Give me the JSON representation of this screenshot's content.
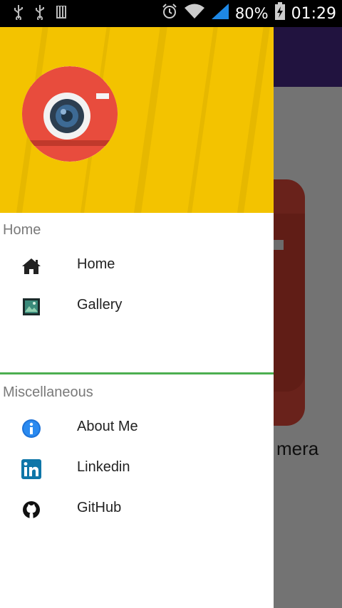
{
  "status_bar": {
    "battery_percent": "80%",
    "time": "01:29",
    "icons": [
      "usb-icon",
      "usb-icon",
      "sd-card-icon",
      "alarm-icon",
      "wifi-icon",
      "signal-icon",
      "battery-charging-icon"
    ]
  },
  "background_app": {
    "label_partial": "mera",
    "toolbar_color": "#4a2b8c"
  },
  "drawer": {
    "header_color": "#f3c300",
    "sections": [
      {
        "title": "Home",
        "items": [
          {
            "label": "Home",
            "icon": "home-icon"
          },
          {
            "label": "Gallery",
            "icon": "gallery-icon"
          }
        ]
      },
      {
        "title": "Miscellaneous",
        "items": [
          {
            "label": "About Me",
            "icon": "info-icon"
          },
          {
            "label": "Linkedin",
            "icon": "linkedin-icon"
          },
          {
            "label": "GitHub",
            "icon": "github-icon"
          }
        ]
      }
    ],
    "divider_color": "#4caf50"
  }
}
